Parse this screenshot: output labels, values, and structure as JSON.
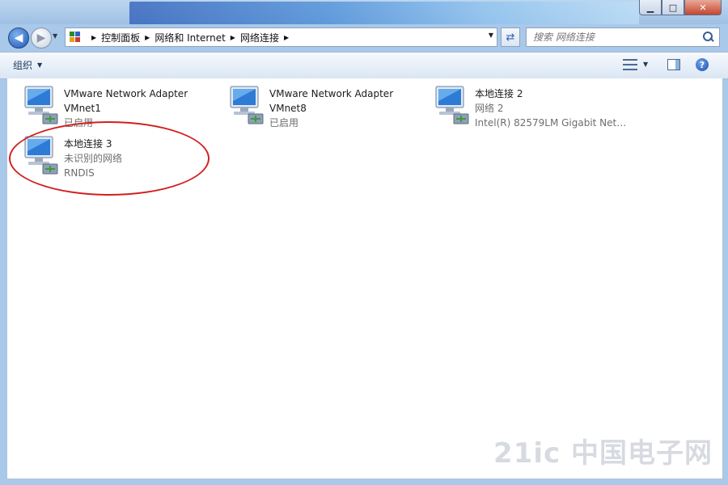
{
  "window": {
    "controls": {
      "minimize_icon": "minimize-icon",
      "maximize_icon": "maximize-icon",
      "close_icon": "close-icon"
    }
  },
  "nav": {
    "back_icon": "back-arrow-icon",
    "forward_icon": "forward-arrow-icon",
    "breadcrumbs": [
      "控制面板",
      "网络和 Internet",
      "网络连接"
    ],
    "search_placeholder": "搜索 网络连接"
  },
  "toolbar": {
    "organize_label": "组织",
    "view_icon": "change-view-icon",
    "preview_icon": "preview-pane-icon",
    "help_icon": "help-icon"
  },
  "adapters": [
    {
      "name_line1": "VMware Network Adapter",
      "name_line2": "VMnet1",
      "status": "已启用",
      "device": ""
    },
    {
      "name_line1": "VMware Network Adapter",
      "name_line2": "VMnet8",
      "status": "已启用",
      "device": ""
    },
    {
      "name_line1": "本地连接 2",
      "name_line2": "",
      "status": "网络  2",
      "device": "Intel(R) 82579LM Gigabit Netw..."
    },
    {
      "name_line1": "本地连接 3",
      "name_line2": "",
      "status": "未识别的网络",
      "device": "RNDIS"
    }
  ],
  "watermark": {
    "text": "21ic 中国电子网"
  },
  "colors": {
    "accent": "#1c57b8",
    "callout": "#d21f1f",
    "status_gray": "#6d6d6d"
  }
}
